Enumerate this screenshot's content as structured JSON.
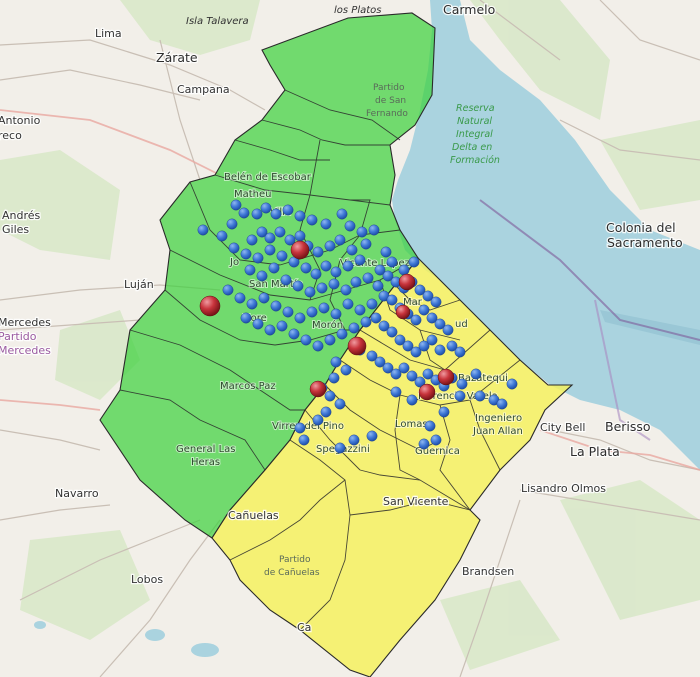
{
  "map": {
    "colors": {
      "land": "#f2efe9",
      "water": "#aad3df",
      "green_zone": "#3fd13f",
      "yellow_zone": "#f5f25a",
      "blue_marker": "#3f78d6",
      "red_marker": "#c8343c"
    },
    "labels": {
      "lima": "Lima",
      "zarate": "Zárate",
      "isla_talavera": "Isla Talavera",
      "los_platos": "los Platos",
      "carmelo": "Carmelo",
      "campana": "Campana",
      "antonio": "Antonio",
      "reco": "reco",
      "andres": "Andrés",
      "giles": "Giles",
      "lujan": "Luján",
      "mercedes": "Mercedes",
      "partido_mercedes": "Partido",
      "partido_mercedes2": "Mercedes",
      "partido_san_fernando_1": "Partido",
      "partido_san_fernando_2": "de San",
      "partido_san_fernando_3": "Fernando",
      "reserva_1": "Reserva",
      "reserva_2": "Natural",
      "reserva_3": "Integral",
      "reserva_4": "Delta en",
      "reserva_5": "Formación",
      "belen": "Belén de Escobar",
      "matheu": "Matheu",
      "villa": "Villa",
      "vicente_lopez": "Vicente López",
      "san_martin": "San Martín",
      "jo": "Jo",
      "more": "More",
      "moron": "Morón",
      "mar": "Mar",
      "ud": "ud",
      "marcos_paz": "Marcos Paz",
      "virrey_del_pino": "Virrey del Pino",
      "general_las_heras_1": "General Las",
      "general_las_heras_2": "Heras",
      "ezeiza": "Spegazzini",
      "lomas": "Lomas",
      "guernica": "Guernica",
      "bazatequi": "Bazatequi",
      "florencio": "Florencio Varela",
      "ingeniero": "Ingeniero",
      "juan_allan": "Juan Allan",
      "city_bell": "City Bell",
      "berisso": "Berisso",
      "la_plata": "La Plata",
      "lisandro_olmos": "Lisandro Olmos",
      "colonia_1": "Colonia del",
      "colonia_2": "Sacramento",
      "navarro": "Navarro",
      "canuelas": "Cañuelas",
      "partido_canuelas_1": "Partido",
      "partido_canuelas_2": "de Cañuelas",
      "lobos": "Lobos",
      "san_vicente": "San Vicente",
      "brandsen": "Brandsen",
      "ca": "Ca"
    }
  }
}
